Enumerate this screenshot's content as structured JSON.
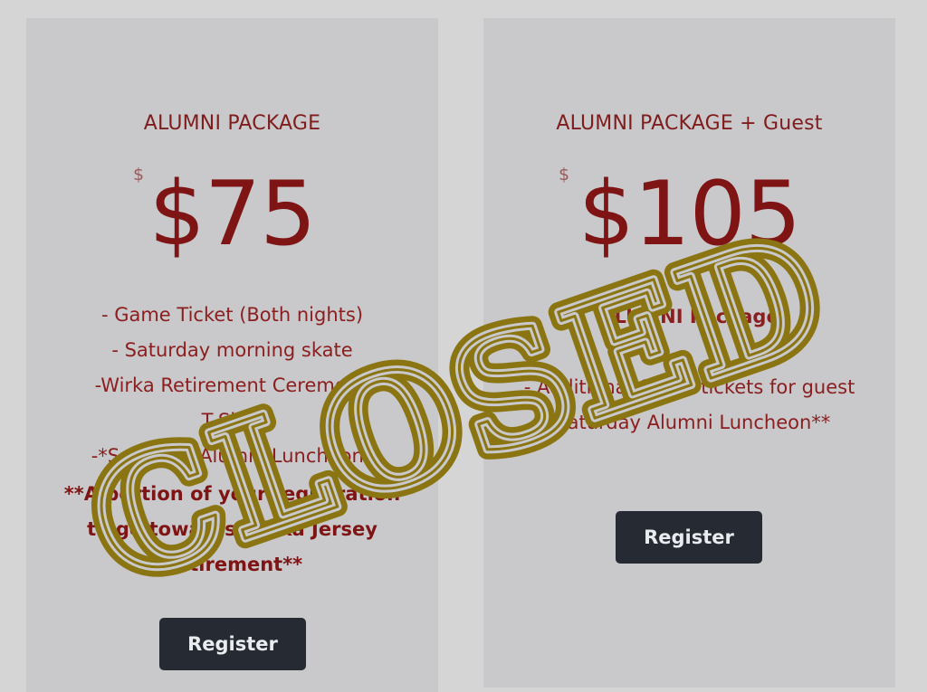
{
  "packages": [
    {
      "title": "ALUMNI PACKAGE",
      "currency_symbol": "$",
      "price": "$75",
      "features": [
        "- Game Ticket (Both nights)",
        "- Saturday morning skate",
        "-Wirka Retirement Ceremony",
        "T-Shirt",
        "-*Saturday Alumni Luncheon*"
      ],
      "note": "**A portion of your registration to go towards Wirka Jersey Retirement**",
      "button_label": "Register"
    },
    {
      "title": "ALUMNI PACKAGE + Guest",
      "currency_symbol": "$",
      "price": "$105",
      "features_bold": "ALUMNI Package",
      "features": [
        "- Additional Game tickets for guest",
        "-Saturday Alumni Luncheon**"
      ],
      "button_label": "Register"
    }
  ],
  "stamp": {
    "text": "CLOSED",
    "color": "#8a7512"
  },
  "colors": {
    "background": "#d5d5d6",
    "card": "#c9c8cb",
    "accent": "#7f1414",
    "button": "#262a33"
  }
}
